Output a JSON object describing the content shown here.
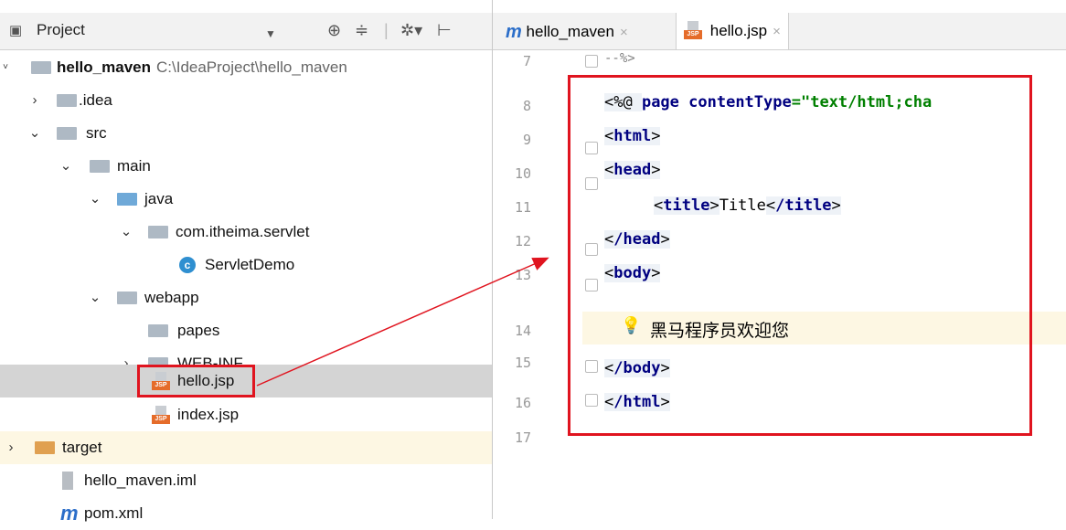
{
  "project_panel": {
    "title": "Project",
    "tree": [
      {
        "label": "hello_maven",
        "path": "C:\\IdeaProject\\hello_maven"
      },
      {
        "label": ".idea"
      },
      {
        "label": "src"
      },
      {
        "label": "main"
      },
      {
        "label": "java"
      },
      {
        "label": "com.itheima.servlet"
      },
      {
        "label": "ServletDemo"
      },
      {
        "label": "webapp"
      },
      {
        "label": "papes"
      },
      {
        "label": "WEB-INF"
      },
      {
        "label": "hello.jsp"
      },
      {
        "label": "index.jsp"
      },
      {
        "label": "target"
      },
      {
        "label": "hello_maven.iml"
      },
      {
        "label": "pom.xml"
      }
    ]
  },
  "tabs": [
    {
      "label": "hello_maven",
      "icon": "maven-icon",
      "active": false
    },
    {
      "label": "hello.jsp",
      "icon": "jsp-file-icon",
      "active": true
    }
  ],
  "editor": {
    "line_numbers": [
      "7",
      "8",
      "9",
      "10",
      "11",
      "12",
      "13",
      "14",
      "15",
      "16",
      "17"
    ],
    "code": {
      "l7": "--%>",
      "l8_a": "<%@ ",
      "l8_b": "page ",
      "l8_c": "contentType",
      "l8_d": "=\"text/html;cha",
      "l9_a": "<",
      "l9_b": "html",
      "l9_c": ">",
      "l10_b": "head",
      "l11_b": "title",
      "l11_text": "Title",
      "l12_b": "/head",
      "l13_b": "body",
      "l14_text": "黑马程序员欢迎您",
      "l15_b": "/body",
      "l16_b": "/html"
    }
  },
  "colors": {
    "annotation_red": "#e0141f",
    "keyword_blue": "#000080",
    "string_green": "#008000",
    "current_line": "#fdf7e3",
    "selected_row": "#d4d4d4"
  }
}
